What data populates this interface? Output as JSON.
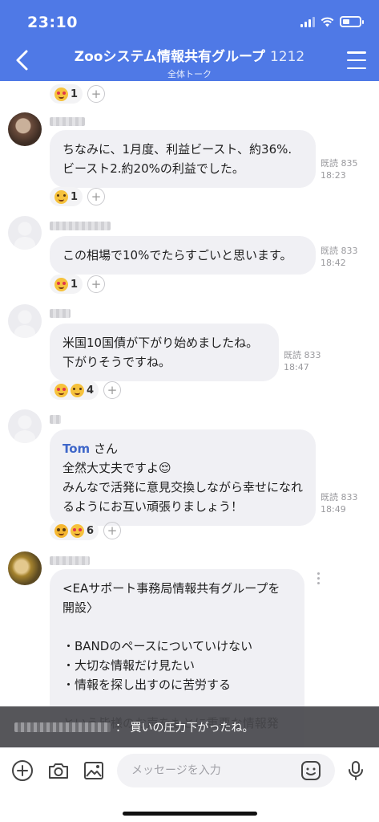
{
  "status_bar": {
    "time": "23:10"
  },
  "header": {
    "title": "Zooシステム情報共有グループ",
    "member_count": "1212",
    "subtitle": "全体トーク",
    "back_icon": "chevron-left-icon",
    "menu_icon": "hamburger-menu-icon"
  },
  "messages": [
    {
      "text": "ちなみに、1月度、利益ビースト、約36%.\nビースト2.約20%の利益でした。",
      "read": "既読 835",
      "time": "18:23",
      "reaction_count": "1"
    },
    {
      "text": "この相場で10%でたらすごいと思います。",
      "read": "既読 833",
      "time": "18:42",
      "reaction_count": "1"
    },
    {
      "text": "米国10国債が下がり始めましたね。\n下がりそうですね。",
      "read": "既読 833",
      "time": "18:47",
      "reaction_count": "4"
    },
    {
      "mention": "Tom",
      "mention_suffix": " さん",
      "text": "全然大丈夫ですよ😌\nみんなで活発に意見交換しながら幸せになれるようにお互い頑張りましょう！",
      "read": "既読 833",
      "time": "18:49",
      "reaction_count": "6"
    },
    {
      "text": "<EAサポート事務局情報共有グループを開設〉\n\n・BANDのペースについていけない\n・大切な情報だけ見たい\n・情報を探し出すのに苦労する\n\nという皆様のお声をもとに重要な情報発"
    }
  ],
  "top_reaction_count": "1",
  "toast": {
    "text": "： 買いの圧力下がったね。"
  },
  "input": {
    "placeholder": "メッセージを入力"
  },
  "icons": [
    "plus-circle-icon",
    "camera-icon",
    "image-icon",
    "sticker-icon",
    "microphone-icon"
  ],
  "colors": {
    "header_bg": "#4f79e6",
    "bubble_bg": "#f0f0f4",
    "mention": "#3f67c9"
  }
}
